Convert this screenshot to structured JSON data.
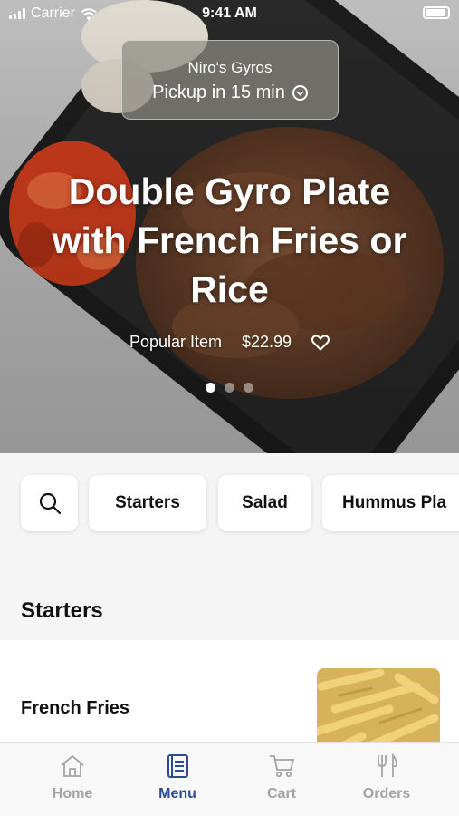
{
  "status_bar": {
    "carrier": "Carrier",
    "time": "9:41 AM"
  },
  "hero": {
    "restaurant": "Niro's Gyros",
    "pickup": "Pickup in 15 min",
    "title": "Double Gyro Plate with French Fries or Rice",
    "tag": "Popular Item",
    "price": "$22.99",
    "slide_count": 3,
    "active_slide": 1
  },
  "categories": [
    {
      "icon": "search-icon"
    },
    {
      "label": "Starters"
    },
    {
      "label": "Salad"
    },
    {
      "label": "Hummus Pla"
    }
  ],
  "section": {
    "title": "Starters"
  },
  "items": [
    {
      "name": "French Fries"
    }
  ],
  "tabs": [
    {
      "label": "Home",
      "icon": "home-icon"
    },
    {
      "label": "Menu",
      "icon": "menu-book-icon",
      "active": true
    },
    {
      "label": "Cart",
      "icon": "cart-icon"
    },
    {
      "label": "Orders",
      "icon": "fork-knife-icon"
    }
  ],
  "colors": {
    "accent": "#2b4a98",
    "inactive_tab": "#a3a3a3"
  }
}
